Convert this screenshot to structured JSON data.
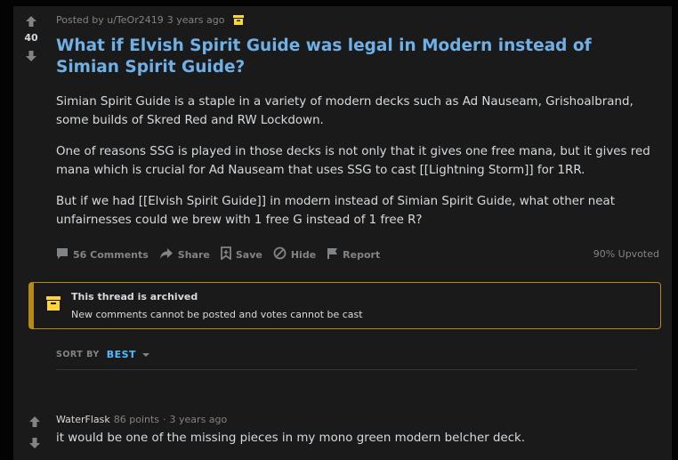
{
  "post": {
    "posted_by": "Posted by u/TeOr2419",
    "age": "3 years ago",
    "score": "40",
    "title": "What if Elvish Spirit Guide was legal in Modern instead of Simian Spirit Guide?",
    "paragraphs": [
      "Simian Spirit Guide is a staple in a variety of modern decks such as Ad Nauseam, Grishoalbrand, some builds of Skred Red and RW Lockdown.",
      "One of reasons SSG is played in those decks is not only that it gives one free mana, but it gives red mana which is crucial for Ad Nauseam that uses SSG to cast [[Lightning Storm]] for 1RR.",
      "But if we had [[Elvish Spirit Guide]] in modern instead of Simian Spirit Guide, what other neat unfairnesses could we brew with 1 free G instead of 1 free R?"
    ]
  },
  "actions": {
    "comments": "56 Comments",
    "share": "Share",
    "save": "Save",
    "hide": "Hide",
    "report": "Report",
    "upvoted": "90% Upvoted"
  },
  "archived": {
    "title": "This thread is archived",
    "message": "New comments cannot be posted and votes cannot be cast"
  },
  "sort": {
    "label": "SORT BY",
    "value": "BEST"
  },
  "comment": {
    "author": "WaterFlask",
    "points": "86 points",
    "separator": "·",
    "age": "3 years ago",
    "text": "it would be one of the missing pieces in my mono green modern belcher deck."
  },
  "colors": {
    "background": "#030303",
    "card": "#1a1a1b",
    "title": "#6fb1e6",
    "archive_accent": "#b58b15",
    "sort_accent": "#4fbcff"
  },
  "icons": [
    "upvote-icon",
    "downvote-icon",
    "archive-icon",
    "comment-icon",
    "share-icon",
    "save-icon",
    "hide-icon",
    "report-icon",
    "chevron-down-icon"
  ]
}
